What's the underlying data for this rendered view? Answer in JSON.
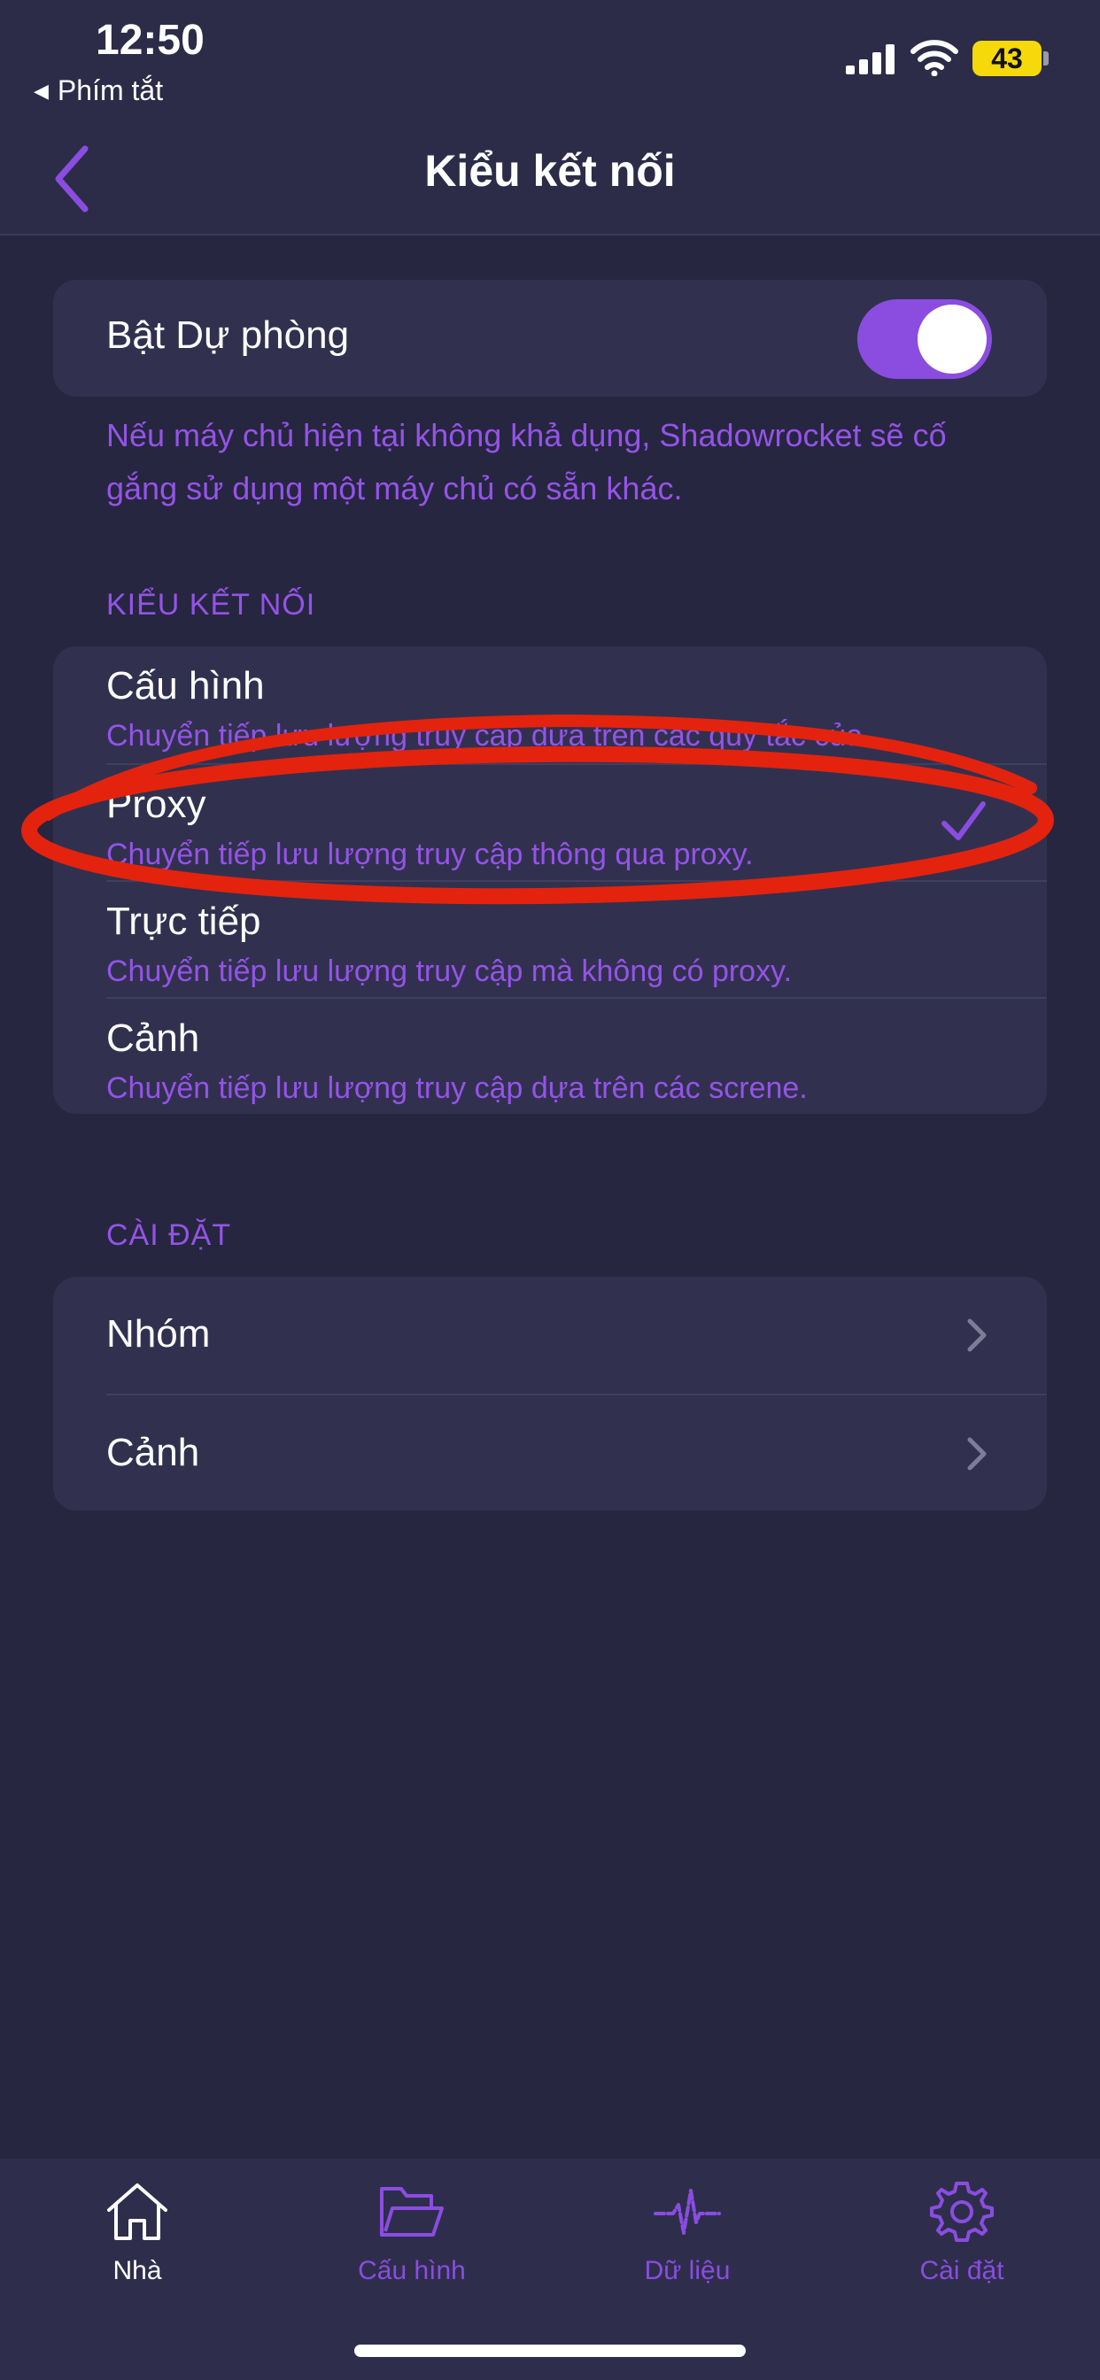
{
  "status_bar": {
    "time": "12:50",
    "back_app": "Phím tắt",
    "battery": "43",
    "icons": [
      "signal-icon",
      "wifi-icon",
      "battery-icon"
    ]
  },
  "nav": {
    "title": "Kiểu kết nối",
    "back_icon": "chevron-left-icon"
  },
  "fallback": {
    "label": "Bật Dự phòng",
    "enabled": true,
    "note": "Nếu máy chủ hiện tại không khả dụng, Shadowrocket sẽ cố gắng sử dụng một máy chủ có sẵn khác."
  },
  "modes": {
    "section_label": "KIỂU KẾT NỐI",
    "selected": "Proxy",
    "items": [
      {
        "title": "Cấu hình",
        "subtitle": "Chuyển tiếp lưu lượng truy cập dựa trên các quy tắc của..."
      },
      {
        "title": "Proxy",
        "subtitle": "Chuyển tiếp lưu lượng truy cập thông qua proxy."
      },
      {
        "title": "Trực tiếp",
        "subtitle": "Chuyển tiếp lưu lượng truy cập mà không có proxy."
      },
      {
        "title": "Cảnh",
        "subtitle": "Chuyển tiếp lưu lượng truy cập dựa trên các screne."
      }
    ]
  },
  "settings": {
    "section_label": "CÀI ĐẶT",
    "items": [
      {
        "title": "Nhóm"
      },
      {
        "title": "Cảnh"
      }
    ]
  },
  "tabs": [
    {
      "label": "Nhà",
      "icon": "home-icon",
      "active": true
    },
    {
      "label": "Cấu hình",
      "icon": "folder-icon",
      "active": false
    },
    {
      "label": "Dữ liệu",
      "icon": "pulse-icon",
      "active": false
    },
    {
      "label": "Cài đặt",
      "icon": "gear-icon",
      "active": false
    }
  ],
  "colors": {
    "background": "#262640",
    "card": "#31314f",
    "accent": "#8a4de0",
    "annotation": "#e3230d"
  }
}
